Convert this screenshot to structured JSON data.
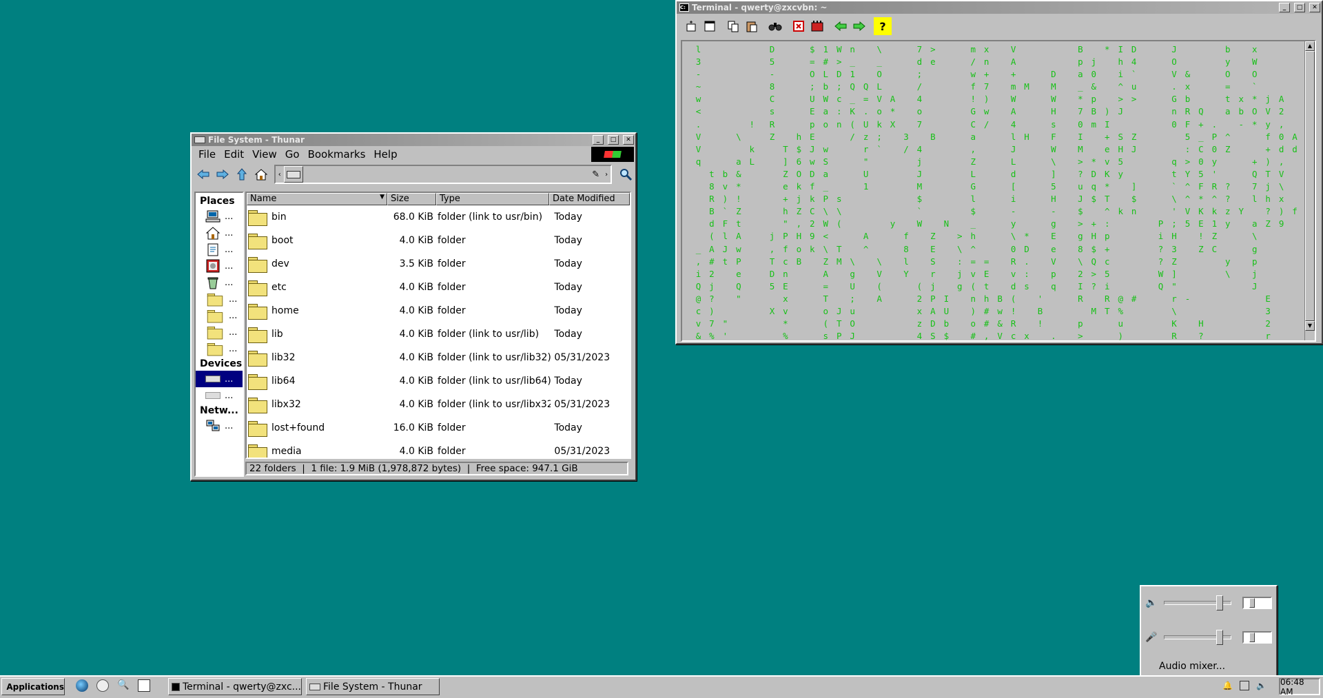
{
  "desktop": {
    "background": "#008080"
  },
  "thunar": {
    "title": "File System - Thunar",
    "menu": [
      "File",
      "Edit",
      "View",
      "Go",
      "Bookmarks",
      "Help"
    ],
    "sidebar": {
      "places_label": "Places",
      "devices_label": "Devices",
      "network_label": "Netw...",
      "ellipsis": "...",
      "places_icons": [
        "computer-icon",
        "home-icon",
        "documents-icon",
        "pictures-icon",
        "trash-icon",
        "folder-icon",
        "folder-icon",
        "folder-icon",
        "folder-icon"
      ],
      "devices_icons": [
        "drive-icon",
        "drive-icon"
      ],
      "network_icons": [
        "network-icon"
      ]
    },
    "columns": {
      "name": "Name",
      "size": "Size",
      "type": "Type",
      "date": "Date Modified"
    },
    "rows": [
      {
        "name": "bin",
        "size": "68.0 KiB",
        "type": "folder (link to usr/bin)",
        "date": "Today"
      },
      {
        "name": "boot",
        "size": "4.0 KiB",
        "type": "folder",
        "date": "Today"
      },
      {
        "name": "dev",
        "size": "3.5 KiB",
        "type": "folder",
        "date": "Today"
      },
      {
        "name": "etc",
        "size": "4.0 KiB",
        "type": "folder",
        "date": "Today"
      },
      {
        "name": "home",
        "size": "4.0 KiB",
        "type": "folder",
        "date": "Today"
      },
      {
        "name": "lib",
        "size": "4.0 KiB",
        "type": "folder (link to usr/lib)",
        "date": "Today"
      },
      {
        "name": "lib32",
        "size": "4.0 KiB",
        "type": "folder (link to usr/lib32)",
        "date": "05/31/2023"
      },
      {
        "name": "lib64",
        "size": "4.0 KiB",
        "type": "folder (link to usr/lib64)",
        "date": "Today"
      },
      {
        "name": "libx32",
        "size": "4.0 KiB",
        "type": "folder (link to usr/libx32)",
        "date": "05/31/2023"
      },
      {
        "name": "lost+found",
        "size": "16.0 KiB",
        "type": "folder",
        "date": "Today"
      },
      {
        "name": "media",
        "size": "4.0 KiB",
        "type": "folder",
        "date": "05/31/2023"
      }
    ],
    "status": "22 folders  |  1 file: 1.9 MiB (1,978,872 bytes)  |  Free space: 947.1 GiB"
  },
  "terminal": {
    "title": "Terminal - qwerty@zxcvbn: ~",
    "toolbar_icons": [
      "new-tab-icon",
      "new-window-icon",
      "copy-icon",
      "paste-icon",
      "find-icon",
      "fullscreen-icon",
      "preferences-icon",
      "previous-tab-icon",
      "next-tab-icon",
      "help-icon"
    ],
    "text_color": "#17c017",
    "lines": [
      " l          D     $ 1 W n   \\     7 >     m x   V         B   * I D     J       b   x         '   ]",
      " 3          5     = # > _   _     d e     / n   A         p j   h 4     O       y   W         Q !   D",
      " -          -     O L D 1   O     ;       w +   +     D   a 0   i `     V &     O   O         3 0",
      " ~          8     ; b ; Q Q L     /       f 7   m M   M   _ &   ^ u     . x     =   `         ] ! l",
      " w          C     U W c _ = V A   4       ! )   W     W   * p   > >     G b     t x * j A     # X",
      " <          s     E a : K . o *   o       G w   A     H   7 B ) J       n R Q   a b O V 2   z J   U",
      " .       !  R     p o n ( U k X   7       C /   4     s   0 m I         0 F + .   - * y ,   w     %",
      " V     \\    Z   h E     / z ;   3   B     a     l H   F   I   + S Z       5 _ P ^     f 0 A   ;     F E",
      " V       k    T $ J w     r `   / 4       ,     J     W   M   e H J       : C 0 Z     + d d   s X     Q P",
      " q     a L    ] 6 w S     \"       j       Z     L     \\   > * v 5       q > 0 y     + ) ,   ) w     i .",
      "   t b &      Z O D a     U       J       L     d     ]   ? D K y       t Y 5 '     Q T V   H C 2   @ a",
      "   8 v *      e k f _     1       M       G     [     5   u q *   ]     ` ^ F R ?   7 j \\   l O a   Y Q",
      "   R ) !      + j k P s           $       l     i     H   J $ T   $     \\ ^ * ^ ?   l h x   b W l   E &",
      "   B ` Z      h Z C \\ \\           `       $     -     -   $   ^ k n     ' V K k z Y   ? ) f   c b &   C f",
      "   d F t      \" , 2 W (       y   W   N   _     y     g   > + :       P ; 5 E 1 y   a Z 9   $ U I   u s",
      "   ( l A    j P H 9 <     A     f   Z   > h     \\ *   E   g H p       i H   ! Z     \\       F s ! A   O +",
      " _ A J w    , f o k \\ T   ^     8   E   \\ ^     0 D   e   8 $ +       ? 3   Z C     g       & p T ?   9 ,",
      " , # t P    T c B   Z M \\   \\   l   S   : = =   R .   V   \\ Q c       ? Z       y   p       s ; J #   K n",
      " i 2   e    D n     A   g   V   Y   r   j v E   v :   p   2 > 5       W ]       \\   j       p ^ S k   z n",
      " Q j   Q    5 E     =   U   (     ( j   g ( t   d s   q   I ? i       Q \"           J       D ; O R   4 2",
      " @ ?   \"      x     T   ;   A     2 P I   n h B (   '     R   R @ #     r -           E       / v r K   G s ;",
      " c )        X v     o J u         x A U   ) # w !   B       M T %       \\             3     . 3 ;   .   @",
      " v 7 \"        *     ( T O         z D b   o # & R   !     p     u       K   H         2       h   u   O r =",
      " & % '        %     s P J         4 S $   # , V c x   .   >     )       R   ?         r       V   O   \\ \\"
    ]
  },
  "mixer": {
    "label": "Audio mixer..."
  },
  "taskbar": {
    "applications": "Applications",
    "launchers": [
      "browser-icon",
      "globe-icon",
      "search-icon",
      "notes-icon"
    ],
    "tasks": [
      "Terminal - qwerty@zxc...",
      "File System - Thunar"
    ],
    "tray_icons": [
      "notification-icon",
      "network-icon",
      "volume-icon"
    ],
    "clock": "06:48 AM"
  }
}
